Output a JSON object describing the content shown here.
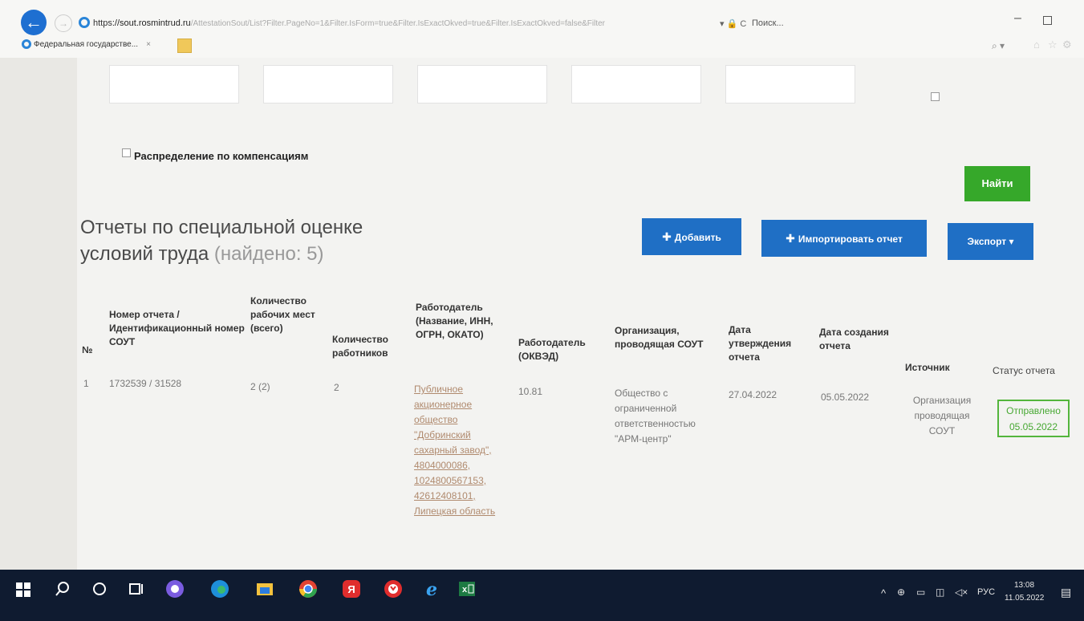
{
  "browser": {
    "url_protocol": "https",
    "url_host": "://sout.rosmintrud.ru",
    "url_rest": "/AttestationSout/List?Filter.PageNo=1&Filter.IsForm=true&Filter.IsExactOkved=true&Filter.IsExactOkved=false&Filter",
    "search_placeholder": "Поиск...",
    "tab_title": "Федеральная государстве...",
    "tab_close": "×",
    "back_arrow": "←",
    "forward_arrow": "→",
    "minimize": "–",
    "lock": "▾ 🔒 C",
    "search_icon": "⌕ ▾"
  },
  "filters": {
    "compensation_label": "Распределение по компенсациям",
    "find_button": "Найти"
  },
  "header": {
    "title": "Отчеты по специальной оценке условий труда",
    "count": "(найдено: 5)",
    "add_button": "Добавить",
    "import_button": "Импортировать отчет",
    "export_button": "Экспорт ▾"
  },
  "table": {
    "columns": {
      "num": "№",
      "report_id": "Номер отчета / Идентификационный номер СОУТ",
      "workplaces": "Количество рабочих мест (всего)",
      "workers": "Количество работников",
      "employer": "Работодатель (Название, ИНН, ОГРН, ОКАТО)",
      "okved": "Работодатель (ОКВЭД)",
      "org": "Организация, проводящая СОУТ",
      "approve_date": "Дата утверждения отчета",
      "create_date": "Дата создания отчета",
      "source": "Источник",
      "status": "Статус отчета"
    },
    "rows": [
      {
        "num": "1",
        "report_id": "1732539 / 31528",
        "workplaces": "2 (2)",
        "workers": "2",
        "employer": "Публичное акционерное общество \"Добринский сахарный завод\", 4804000086, 1024800567153, 42612408101, Липецкая область",
        "okved": "10.81",
        "org": "Общество с ограниченной ответственностью \"АРМ-центр\"",
        "approve_date": "27.04.2022",
        "create_date": "05.05.2022",
        "source": "Организация проводящая СОУТ",
        "status_line1": "Отправлено",
        "status_line2": "05.05.2022"
      }
    ]
  },
  "taskbar": {
    "language": "РУС",
    "time": "13:08",
    "date": "11.05.2022",
    "tray_arrow": "^"
  }
}
